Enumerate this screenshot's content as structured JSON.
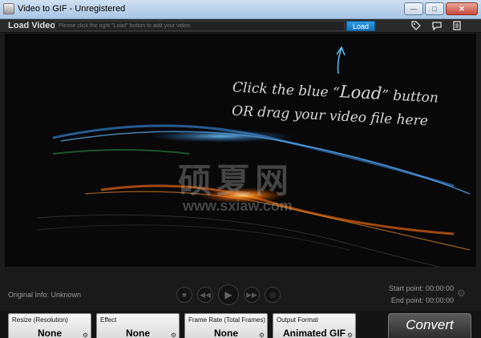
{
  "window": {
    "title": "Video to GIF - Unregistered",
    "buttons": [
      "—",
      "□",
      "✕"
    ]
  },
  "loadbar": {
    "label": "Load Video:",
    "placeholder": "Please click the right \"Load\" button to add your video.",
    "load_button": "Load",
    "icons": [
      "tag-icon",
      "comment-icon",
      "document-icon"
    ]
  },
  "preview": {
    "hint_line1_pre": "Click the blue “",
    "hint_line1_word": "Load",
    "hint_line1_post": "” button",
    "hint_line2": "OR drag your video file here",
    "watermark": "硕夏网",
    "watermark_url": "www.sxiaw.com"
  },
  "player": {
    "original_info": "Original Info: Unknown",
    "start_point": "Start point: 00:00:00",
    "end_point": "End point: 00:00:00"
  },
  "options": [
    {
      "title": "Resize (Resolution)",
      "value": "None"
    },
    {
      "title": "Effect",
      "value": "None"
    },
    {
      "title": "Frame Rate",
      "title_suffix": "(Total Frames)",
      "value": "None"
    },
    {
      "title": "Output Format",
      "value": "Animated GIF"
    }
  ],
  "convert_label": "Convert",
  "colors": {
    "load_button": "#1f86cc",
    "accent_blue": "#38a8ff",
    "accent_orange": "#ff8a1e"
  }
}
